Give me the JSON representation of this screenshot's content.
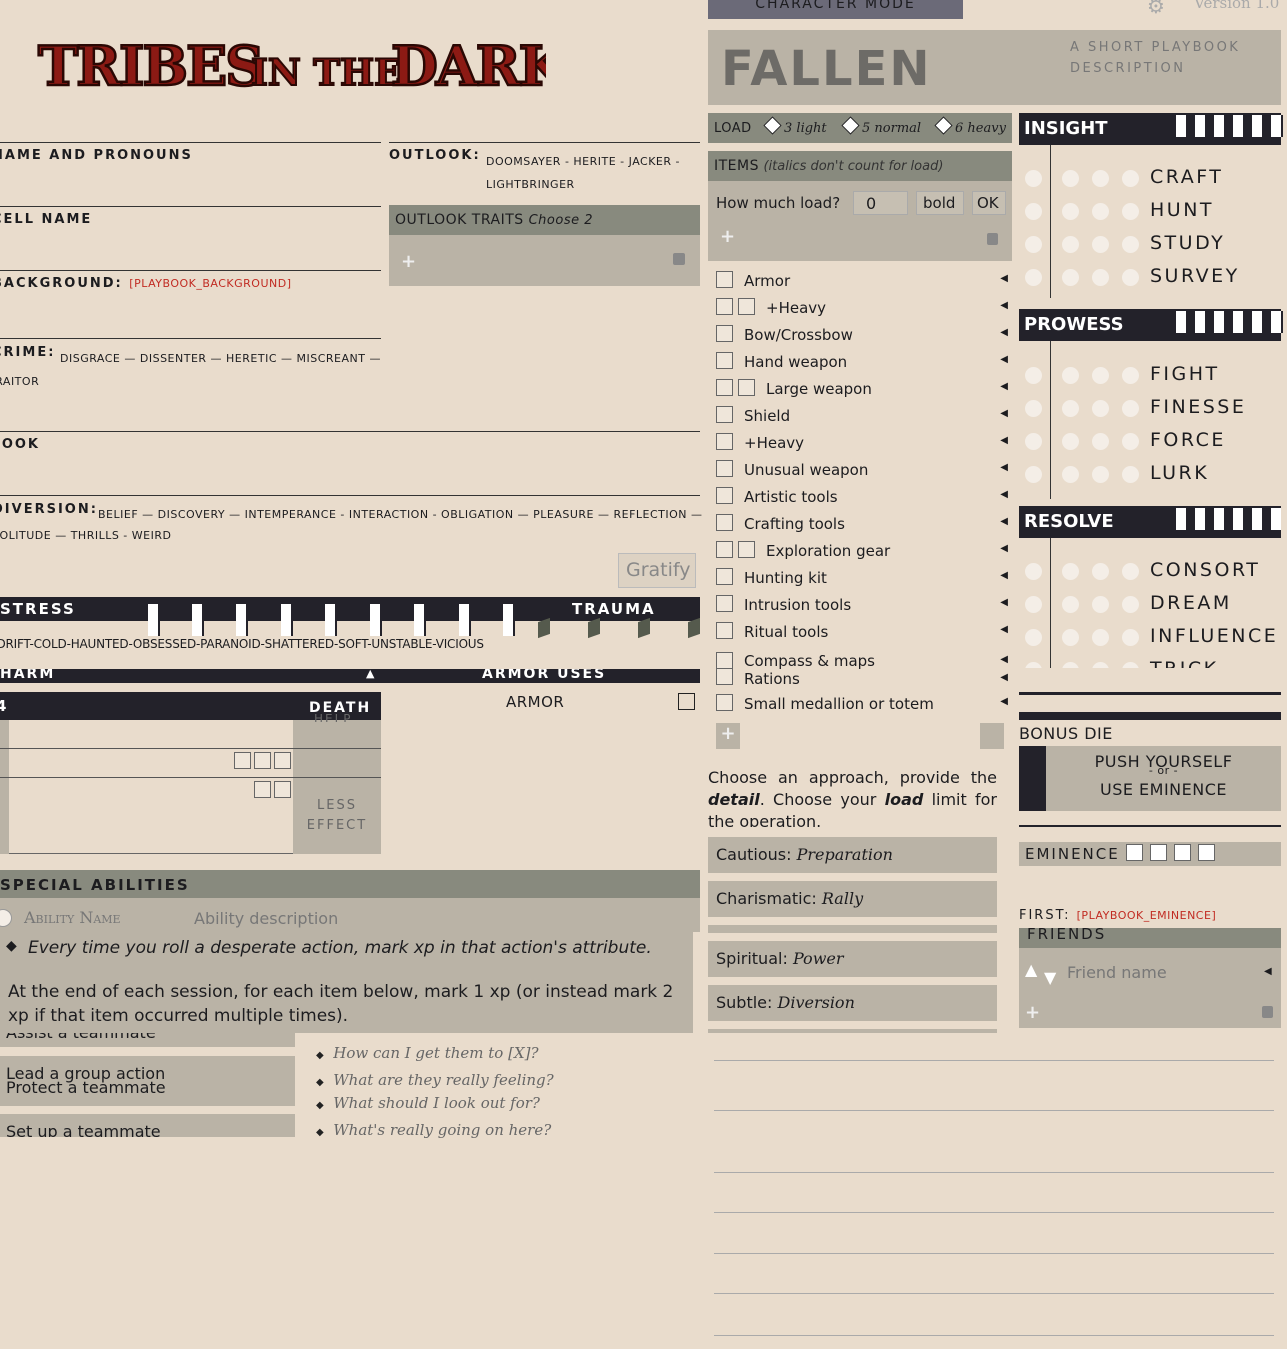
{
  "top": {
    "mode_tab": "CHARACTER MODE",
    "version": "Version 1.0",
    "gear": "gear-icon"
  },
  "logo": {
    "text": "TRIBES IN THE DARK"
  },
  "playbook": {
    "name": "FALLEN",
    "description": "A SHORT PLAYBOOK DESCRIPTION"
  },
  "fields": {
    "name_label": "NAME AND PRONOUNS",
    "outlook_label": "OUTLOOK:",
    "outlook_options": "DOOMSAYER - HERITE - JACKER - LIGHTBRINGER",
    "cell_label": "CELL NAME",
    "outlook_traits": "OUTLOOK TRAITS",
    "outlook_traits_hint": "Choose 2",
    "background_label": "BACKGROUND:",
    "background_value": "[PLAYBOOK_BACKGROUND]",
    "crime_label": "CRIME:",
    "crime_options": "DISGRACE — DISSENTER — HERETIC — MISCREANT — TRAITOR",
    "look_label": "LOOK",
    "diversion_label": "DIVERSION:",
    "diversion_options": "BELIEF — DISCOVERY — INTEMPERANCE - INTERACTION - OBLIGATION — PLEASURE — REFLECTION — SOLITUDE — THRILLS - WEIRD"
  },
  "gratify": "Gratify",
  "stress": {
    "label": "STRESS",
    "trauma_label": "TRAUMA",
    "traumas": "CAGEDRIFT-COLD-HAUNTED-OBSESSED-PARANOID-SHATTERED-SOFT-UNSTABLE-VICIOUS"
  },
  "harm": {
    "label": "HARM",
    "armor_uses": "ARMOR USES",
    "armor": "ARMOR",
    "row_num": "4",
    "death": "DEATH",
    "help": "HELP",
    "less_effect": "LESS EFFECT"
  },
  "special": {
    "label": "SPECIAL ABILITIES",
    "ability_name": "Ability Name",
    "ability_desc": "Ability description",
    "rule": "Every time you roll a desperate action, mark xp in that action's attribute."
  },
  "xp": {
    "text": "At the end of each session, for each item below, mark 1 xp (or instead mark 2 xp if that item occurred multiple times).",
    "teamwork": [
      "Assist a teammate",
      "Lead a group action",
      "Protect a teammate",
      "Set up a teammate"
    ],
    "questions": [
      "How can I get them to [X]?",
      "What are they really feeling?",
      "What should I look out for?",
      "What's really going on here?"
    ]
  },
  "load": {
    "label": "LOAD",
    "light_n": "3",
    "light": "light",
    "normal_n": "5",
    "normal": "normal",
    "heavy_n": "6",
    "heavy": "heavy"
  },
  "items": {
    "label": "ITEMS",
    "hint": "(italics don't count for load)",
    "how_much": "How much load?",
    "value": "0",
    "bold": "bold",
    "ok": "OK",
    "list": [
      "Armor",
      "+Heavy",
      "Bow/Crossbow",
      "Hand weapon",
      "Large weapon",
      "Shield",
      "+Heavy",
      "Unusual weapon",
      "Artistic tools",
      "Crafting tools",
      "Exploration gear",
      "Hunting kit",
      "Intrusion tools",
      "Ritual tools",
      "Compass & maps",
      "Rations",
      "Small medallion or totem"
    ]
  },
  "plan": {
    "text_a": "Choose an approach, provide the",
    "text_detail": "detail",
    "text_b": ". Choose your",
    "text_load": "load",
    "text_c": "limit for the operation.",
    "approaches": [
      {
        "name": "Cautious:",
        "detail": "Preparation"
      },
      {
        "name": "Charismatic:",
        "detail": "Rally"
      },
      {
        "name": "Spiritual:",
        "detail": "Power"
      },
      {
        "name": "Subtle:",
        "detail": "Diversion"
      }
    ]
  },
  "attributes": [
    {
      "name": "INSIGHT",
      "actions": [
        "CRAFT",
        "HUNT",
        "STUDY",
        "SURVEY"
      ]
    },
    {
      "name": "PROWESS",
      "actions": [
        "FIGHT",
        "FINESSE",
        "FORCE",
        "LURK"
      ]
    },
    {
      "name": "RESOLVE",
      "actions": [
        "CONSORT",
        "DREAM",
        "INFLUENCE",
        "TRICK"
      ]
    }
  ],
  "right": {
    "bonus_die": "BONUS DIE",
    "push": "PUSH YOURSELF",
    "or": "- or -",
    "use_eminence": "USE EMINENCE",
    "eminence": "EMINENCE",
    "first_label": "FIRST:",
    "first_value": "[PLAYBOOK_EMINENCE]",
    "friends": "FRIENDS",
    "friend_placeholder": "Friend name"
  },
  "colors": {
    "bg": "#e9dccc",
    "dark": "#23222a",
    "grey": "#888a7e",
    "panel": "#bab3a6",
    "red": "#c12b22"
  }
}
